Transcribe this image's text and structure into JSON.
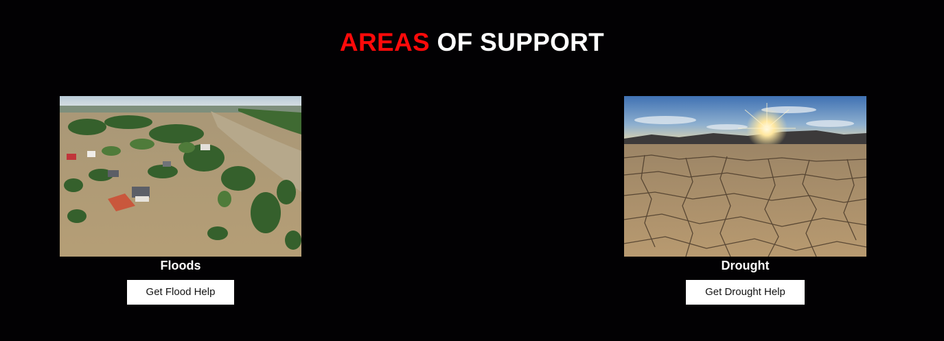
{
  "section": {
    "title_accent": "AREAS",
    "title_rest": "OF SUPPORT",
    "accent_color": "#ff0a0a"
  },
  "cards": [
    {
      "label": "Floods",
      "button_label": "Get Flood Help",
      "image": "flooded-town-aerial-photo"
    },
    {
      "label": "Drought",
      "button_label": "Get Drought Help",
      "image": "cracked-earth-sunset-photo"
    }
  ]
}
